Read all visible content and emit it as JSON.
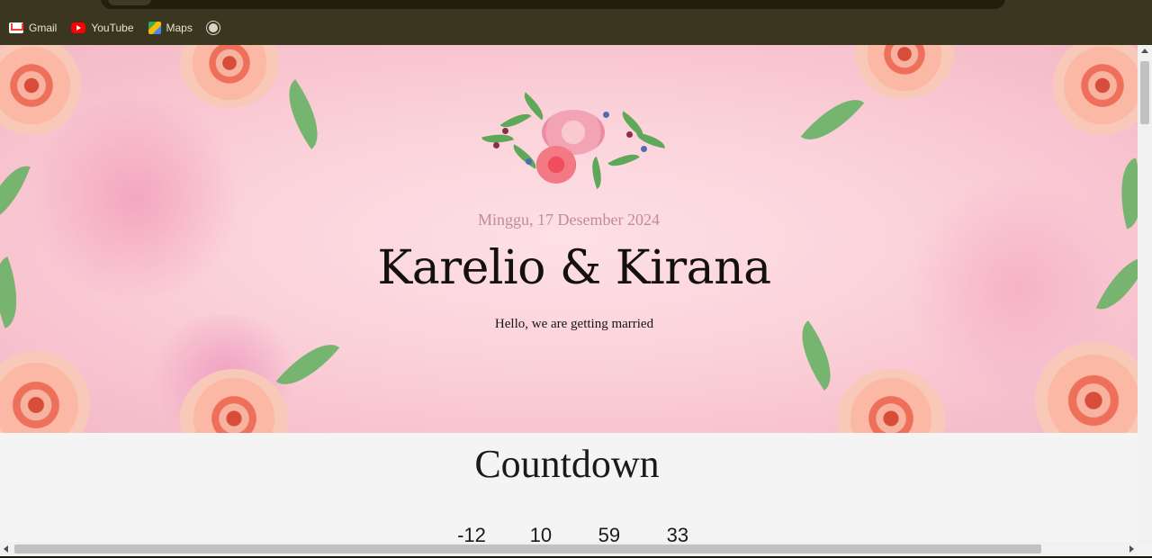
{
  "browser": {
    "bookmarks": [
      {
        "label": "Gmail",
        "icon": "gmail-icon"
      },
      {
        "label": "YouTube",
        "icon": "youtube-icon"
      },
      {
        "label": "Maps",
        "icon": "maps-icon"
      },
      {
        "label": "",
        "icon": "globe-icon"
      }
    ]
  },
  "hero": {
    "date": "Minggu, 17 Desember 2024",
    "names": "Karelio & Kirana",
    "tagline": "Hello, we are getting married"
  },
  "countdown": {
    "title": "Countdown",
    "values": [
      "-12",
      "10",
      "59",
      "33"
    ]
  },
  "colors": {
    "hero_background": "#fbd2da",
    "accent_date": "#c28a9c",
    "browser_chrome": "#3b3620"
  }
}
